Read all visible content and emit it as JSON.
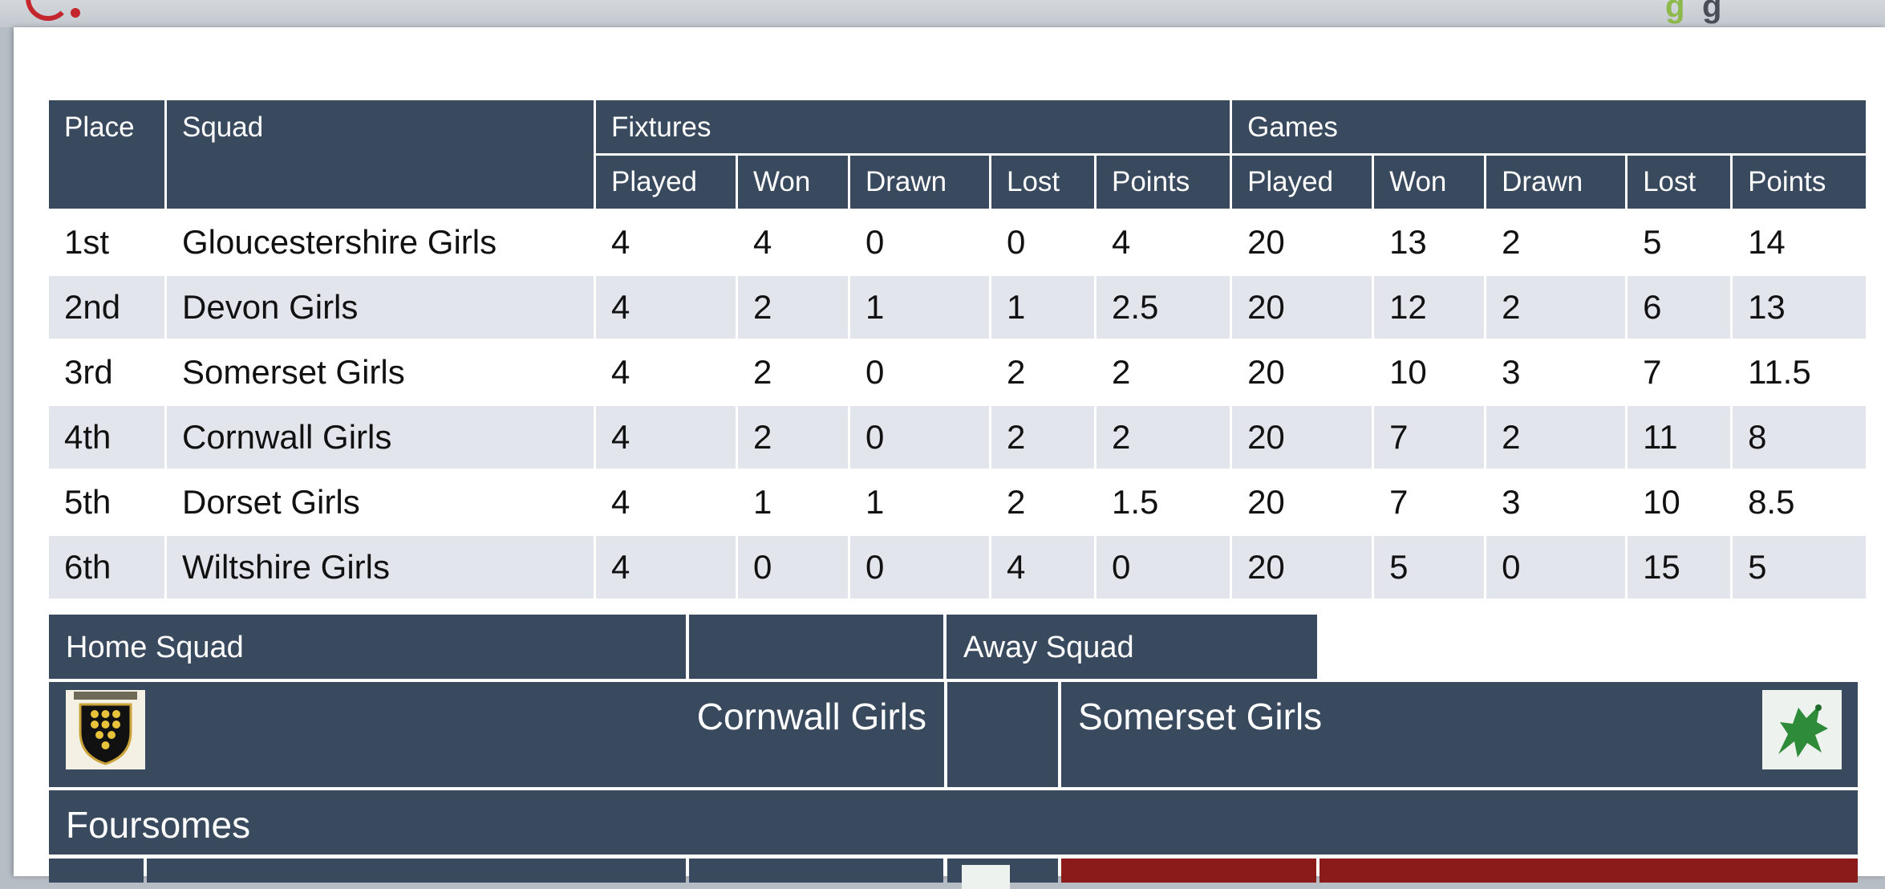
{
  "icons": {
    "logo": "swirl-logo-icon",
    "cornwall_crest": "cornwall-crest-icon",
    "somerset_crest": "somerset-dragon-icon"
  },
  "colors": {
    "header": "#394a5f",
    "row_alt": "#e2e5ec",
    "brand_red": "#c3262d",
    "brand_green": "#8db84a",
    "result_red": "#8b1a1a"
  },
  "brand": {
    "glyph1": "g",
    "glyph2": "g"
  },
  "standings": {
    "headers": {
      "place": "Place",
      "squad": "Squad",
      "fixtures": "Fixtures",
      "games": "Games",
      "fixtures_cols": [
        "Played",
        "Won",
        "Drawn",
        "Lost",
        "Points"
      ],
      "games_cols": [
        "Played",
        "Won",
        "Drawn",
        "Lost",
        "Points"
      ]
    },
    "rows": [
      {
        "place": "1st",
        "squad": "Gloucestershire Girls",
        "f_played": "4",
        "f_won": "4",
        "f_drawn": "0",
        "f_lost": "0",
        "f_points": "4",
        "g_played": "20",
        "g_won": "13",
        "g_drawn": "2",
        "g_lost": "5",
        "g_points": "14"
      },
      {
        "place": "2nd",
        "squad": "Devon Girls",
        "f_played": "4",
        "f_won": "2",
        "f_drawn": "1",
        "f_lost": "1",
        "f_points": "2.5",
        "g_played": "20",
        "g_won": "12",
        "g_drawn": "2",
        "g_lost": "6",
        "g_points": "13"
      },
      {
        "place": "3rd",
        "squad": "Somerset Girls",
        "f_played": "4",
        "f_won": "2",
        "f_drawn": "0",
        "f_lost": "2",
        "f_points": "2",
        "g_played": "20",
        "g_won": "10",
        "g_drawn": "3",
        "g_lost": "7",
        "g_points": "11.5"
      },
      {
        "place": "4th",
        "squad": "Cornwall Girls",
        "f_played": "4",
        "f_won": "2",
        "f_drawn": "0",
        "f_lost": "2",
        "f_points": "2",
        "g_played": "20",
        "g_won": "7",
        "g_drawn": "2",
        "g_lost": "11",
        "g_points": "8"
      },
      {
        "place": "5th",
        "squad": "Dorset Girls",
        "f_played": "4",
        "f_won": "1",
        "f_drawn": "1",
        "f_lost": "2",
        "f_points": "1.5",
        "g_played": "20",
        "g_won": "7",
        "g_drawn": "3",
        "g_lost": "10",
        "g_points": "8.5"
      },
      {
        "place": "6th",
        "squad": "Wiltshire Girls",
        "f_played": "4",
        "f_won": "0",
        "f_drawn": "0",
        "f_lost": "4",
        "f_points": "0",
        "g_played": "20",
        "g_won": "5",
        "g_drawn": "0",
        "g_lost": "15",
        "g_points": "5"
      }
    ]
  },
  "match": {
    "home_label": "Home Squad",
    "away_label": "Away Squad",
    "home_team": "Cornwall Girls",
    "away_team": "Somerset Girls",
    "section": "Foursomes"
  }
}
